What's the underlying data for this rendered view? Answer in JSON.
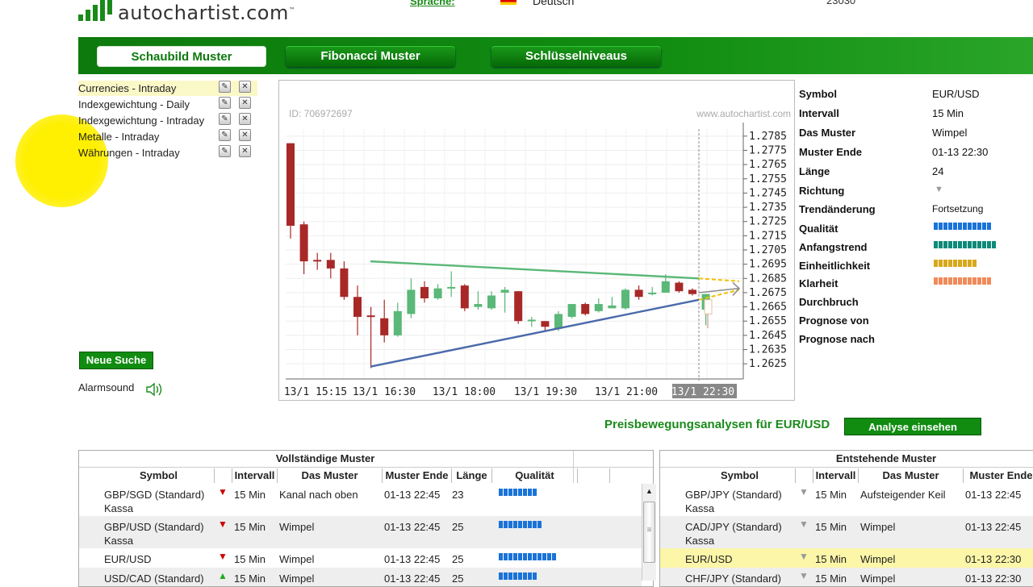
{
  "header": {
    "logo_text": "autochartist.com",
    "logo_tm": "™",
    "lang_link": "Sprache:",
    "lang_value": "Deutsch",
    "top_right": "23030"
  },
  "nav": {
    "tabs": [
      {
        "label": "Schaubild Muster"
      },
      {
        "label": "Fibonacci Muster"
      },
      {
        "label": "Schlüsselniveaus"
      }
    ]
  },
  "watchlists": [
    {
      "label": "Currencies - Intraday"
    },
    {
      "label": "Indexgewichtung - Daily"
    },
    {
      "label": "Indexgewichtung - Intraday"
    },
    {
      "label": "Metalle - Intraday"
    },
    {
      "label": "Währungen - Intraday"
    }
  ],
  "new_search_label": "Neue Suche",
  "alarm_label": "Alarmsound",
  "chart": {
    "id_text": "ID: 706972697",
    "watermark": "www.autochartist.com",
    "y_ticks": [
      "1.2785",
      "1.2775",
      "1.2765",
      "1.2755",
      "1.2745",
      "1.2735",
      "1.2725",
      "1.2715",
      "1.2705",
      "1.2695",
      "1.2685",
      "1.2675",
      "1.2665",
      "1.2655",
      "1.2645",
      "1.2635",
      "1.2625"
    ],
    "x_ticks": [
      "13/1 15:15",
      "13/1 16:30",
      "13/1 18:00",
      "13/1 19:30",
      "13/1 21:00",
      "13/1 22:30"
    ]
  },
  "chart_data": {
    "type": "candlestick",
    "ylim": [
      1.262,
      1.279
    ],
    "candles": [
      {
        "o": 1.278,
        "c": 1.2722,
        "h": 1.278,
        "l": 1.2713,
        "up": false
      },
      {
        "o": 1.2723,
        "c": 1.2697,
        "h": 1.2725,
        "l": 1.2688,
        "up": false
      },
      {
        "o": 1.2698,
        "c": 1.2697,
        "h": 1.2703,
        "l": 1.2691,
        "up": false
      },
      {
        "o": 1.2698,
        "c": 1.2692,
        "h": 1.2703,
        "l": 1.2685,
        "up": false
      },
      {
        "o": 1.2692,
        "c": 1.2672,
        "h": 1.2697,
        "l": 1.267,
        "up": false
      },
      {
        "o": 1.2672,
        "c": 1.2658,
        "h": 1.268,
        "l": 1.2645,
        "up": false
      },
      {
        "o": 1.2659,
        "c": 1.2658,
        "h": 1.2665,
        "l": 1.2622,
        "up": false
      },
      {
        "o": 1.2657,
        "c": 1.2645,
        "h": 1.267,
        "l": 1.264,
        "up": false
      },
      {
        "o": 1.2645,
        "c": 1.2662,
        "h": 1.2668,
        "l": 1.2644,
        "up": true
      },
      {
        "o": 1.266,
        "c": 1.2677,
        "h": 1.2685,
        "l": 1.2657,
        "up": true
      },
      {
        "o": 1.2679,
        "c": 1.2671,
        "h": 1.2683,
        "l": 1.2668,
        "up": false
      },
      {
        "o": 1.2671,
        "c": 1.2678,
        "h": 1.2681,
        "l": 1.267,
        "up": true
      },
      {
        "o": 1.2678,
        "c": 1.2679,
        "h": 1.269,
        "l": 1.2672,
        "up": true
      },
      {
        "o": 1.268,
        "c": 1.2664,
        "h": 1.2681,
        "l": 1.2662,
        "up": false
      },
      {
        "o": 1.2665,
        "c": 1.2667,
        "h": 1.2676,
        "l": 1.2663,
        "up": true
      },
      {
        "o": 1.2664,
        "c": 1.2673,
        "h": 1.2676,
        "l": 1.2663,
        "up": true
      },
      {
        "o": 1.2675,
        "c": 1.2677,
        "h": 1.2679,
        "l": 1.2661,
        "up": true
      },
      {
        "o": 1.2676,
        "c": 1.2655,
        "h": 1.2676,
        "l": 1.2653,
        "up": false
      },
      {
        "o": 1.2655,
        "c": 1.2656,
        "h": 1.2658,
        "l": 1.2651,
        "up": true
      },
      {
        "o": 1.2655,
        "c": 1.2651,
        "h": 1.2655,
        "l": 1.2648,
        "up": false
      },
      {
        "o": 1.265,
        "c": 1.266,
        "h": 1.2662,
        "l": 1.2648,
        "up": true
      },
      {
        "o": 1.2658,
        "c": 1.2667,
        "h": 1.2667,
        "l": 1.2657,
        "up": true
      },
      {
        "o": 1.2667,
        "c": 1.266,
        "h": 1.2668,
        "l": 1.2659,
        "up": false
      },
      {
        "o": 1.2662,
        "c": 1.2667,
        "h": 1.2671,
        "l": 1.2661,
        "up": true
      },
      {
        "o": 1.2664,
        "c": 1.2666,
        "h": 1.2672,
        "l": 1.2664,
        "up": true
      },
      {
        "o": 1.2664,
        "c": 1.2677,
        "h": 1.2678,
        "l": 1.2663,
        "up": true
      },
      {
        "o": 1.2677,
        "c": 1.2672,
        "h": 1.268,
        "l": 1.267,
        "up": false
      },
      {
        "o": 1.2674,
        "c": 1.2675,
        "h": 1.2679,
        "l": 1.2673,
        "up": true
      },
      {
        "o": 1.2675,
        "c": 1.2683,
        "h": 1.2688,
        "l": 1.2675,
        "up": true
      },
      {
        "o": 1.2682,
        "c": 1.2676,
        "h": 1.2683,
        "l": 1.2675,
        "up": false
      },
      {
        "o": 1.2677,
        "c": 1.2674,
        "h": 1.2678,
        "l": 1.2673,
        "up": false
      },
      {
        "o": 1.2674,
        "c": 1.2663,
        "h": 1.2674,
        "l": 1.2652,
        "up": true
      }
    ],
    "trend_upper": {
      "from": 1.2697,
      "to": 1.2685
    },
    "trend_lower": {
      "from": 1.2623,
      "to": 1.267
    }
  },
  "details": [
    {
      "label": "Symbol",
      "value": "EUR/USD"
    },
    {
      "label": "Intervall",
      "value": "15 Min"
    },
    {
      "label": "Das Muster",
      "value": "Wimpel"
    },
    {
      "label": "Muster Ende",
      "value": "01-13 22:30"
    },
    {
      "label": "Länge",
      "value": "24"
    },
    {
      "label": "Richtung",
      "value": "▼"
    },
    {
      "label": "Trendänderung",
      "value": "Fortsetzung"
    },
    {
      "label": "Qualität",
      "value": ""
    },
    {
      "label": "Anfangstrend",
      "value": ""
    },
    {
      "label": "Einheitlichkeit",
      "value": ""
    },
    {
      "label": "Klarheit",
      "value": ""
    },
    {
      "label": "Durchbruch",
      "value": ""
    },
    {
      "label": "Prognose von",
      "value": ""
    },
    {
      "label": "Prognose nach",
      "value": ""
    }
  ],
  "quality_bars": {
    "qualitaet": {
      "count": 12,
      "color": "#1a73d8"
    },
    "anfangstrend": {
      "count": 13,
      "color": "#0e8a7a"
    },
    "einheitlichkeit": {
      "count": 9,
      "color": "#d8a81a"
    },
    "klarheit": {
      "count": 12,
      "color": "#f08a5a"
    }
  },
  "price_analysis": {
    "label": "Preisbewegungsanalysen für EUR/USD",
    "button": "Analyse einsehen"
  },
  "completed": {
    "title": "Vollständige Muster",
    "headers": [
      "Symbol",
      "Intervall",
      "Das Muster",
      "Muster Ende",
      "Länge",
      "Qualität"
    ],
    "rows": [
      {
        "symbol": "GBP/SGD (Standard)",
        "sub": "Kassa",
        "dir": "down",
        "interval": "15 Min",
        "pattern": "Kanal nach oben",
        "end": "01-13 22:45",
        "len": "23",
        "q": 8
      },
      {
        "symbol": "GBP/USD (Standard)",
        "sub": "Kassa",
        "dir": "down",
        "interval": "15 Min",
        "pattern": "Wimpel",
        "end": "01-13 22:45",
        "len": "25",
        "q": 9
      },
      {
        "symbol": "EUR/USD",
        "sub": "",
        "dir": "down",
        "interval": "15 Min",
        "pattern": "Wimpel",
        "end": "01-13 22:45",
        "len": "25",
        "q": 12
      },
      {
        "symbol": "USD/CAD (Standard)",
        "sub": "",
        "dir": "up",
        "interval": "15 Min",
        "pattern": "Wimpel",
        "end": "01-13 22:45",
        "len": "25",
        "q": 8
      }
    ]
  },
  "emerging": {
    "title": "Entstehende Muster",
    "headers": [
      "Symbol",
      "Intervall",
      "Das Muster",
      "Muster Ende"
    ],
    "rows": [
      {
        "symbol": "GBP/JPY (Standard)",
        "sub": "Kassa",
        "interval": "15 Min",
        "pattern": "Aufsteigender Keil",
        "end": "01-13 22:45"
      },
      {
        "symbol": "CAD/JPY (Standard)",
        "sub": "Kassa",
        "interval": "15 Min",
        "pattern": "Wimpel",
        "end": "01-13 22:45"
      },
      {
        "symbol": "EUR/USD",
        "sub": "",
        "interval": "15 Min",
        "pattern": "Wimpel",
        "end": "01-13 22:30"
      },
      {
        "symbol": "CHF/JPY (Standard)",
        "sub": "",
        "interval": "15 Min",
        "pattern": "Wimpel",
        "end": "01-13 22:30"
      }
    ]
  }
}
